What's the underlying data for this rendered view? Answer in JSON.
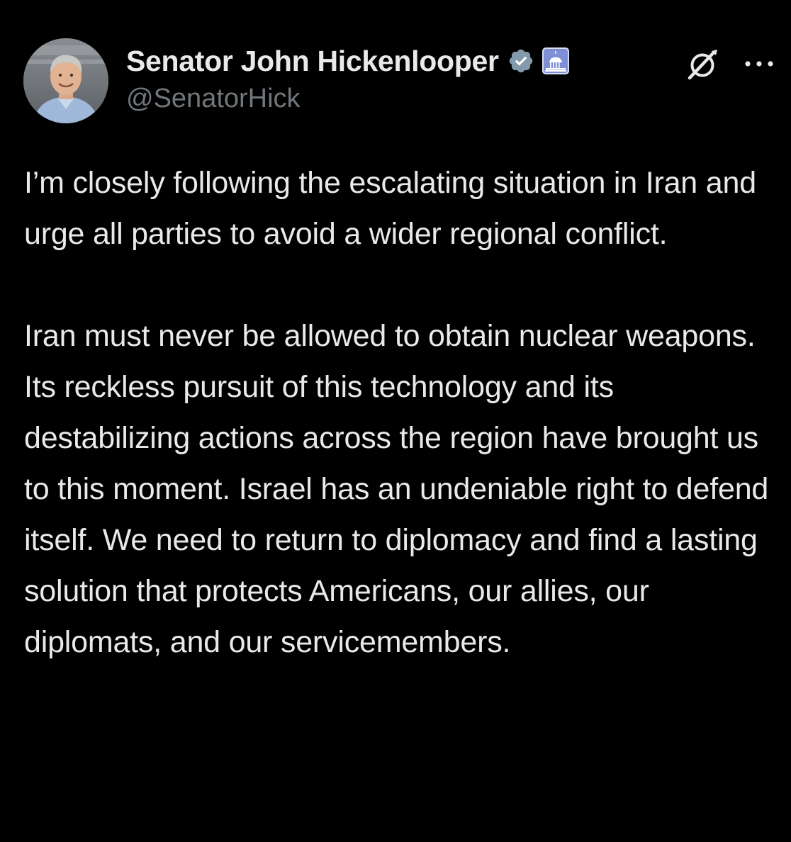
{
  "author": {
    "display_name": "Senator John Hickenlooper",
    "handle": "@SenatorHick",
    "verified_badge_color": "#829aab",
    "affiliation_badge": "capitol-building-icon"
  },
  "actions": {
    "grok_icon": "grok-icon",
    "more_icon": "more-options-icon"
  },
  "tweet": {
    "paragraphs": [
      "I’m closely following the escalating situation in Iran and urge all parties to avoid a wider regional conflict.",
      "Iran must never be allowed to obtain nuclear weapons. Its reckless pursuit of this technology and its destabilizing actions across the region have brought us to this moment. Israel has an undeniable right to defend itself. We need to return to diplomacy and find a lasting solution that protects Americans, our allies, our diplomats, and our servicemembers."
    ]
  },
  "colors": {
    "background": "#000000",
    "text": "#e7e9ea",
    "secondary_text": "#71767b"
  }
}
